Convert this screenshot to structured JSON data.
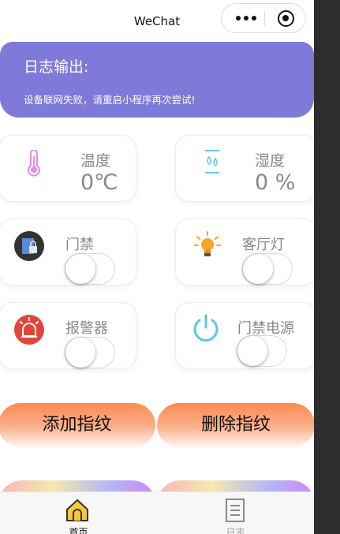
{
  "navbar": {
    "title": "WeChat"
  },
  "log": {
    "title": "日志输出:",
    "message": "设备联网失败，请重启小程序再次尝试!"
  },
  "sensors": {
    "temperature": {
      "label": "温度",
      "value": "0℃",
      "icon": "thermometer-icon",
      "color": "#e28be8"
    },
    "humidity": {
      "label": "湿度",
      "value": "0 %",
      "icon": "humidity-icon",
      "color": "#64d0e0"
    }
  },
  "controls": {
    "door": {
      "label": "门禁",
      "icon": "door-lock-icon",
      "on": false
    },
    "living_room_light": {
      "label": "客厅灯",
      "icon": "light-bulb-icon",
      "on": false
    },
    "alarm": {
      "label": "报警器",
      "icon": "alarm-icon",
      "on": false
    },
    "door_power": {
      "label": "门禁电源",
      "icon": "power-icon",
      "on": false
    }
  },
  "buttons": {
    "add_fingerprint": "添加指纹",
    "delete_fingerprint": "删除指纹"
  },
  "tabbar": {
    "items": [
      {
        "label": "首页",
        "icon": "home-icon",
        "active": true,
        "color": "#111111"
      },
      {
        "label": "日志",
        "icon": "document-icon",
        "active": false,
        "color": "#999999"
      }
    ]
  },
  "colors": {
    "log_bg": "#7f7ad9",
    "button_orange": "#fb8a50",
    "home_icon_fill": "#f5c842"
  }
}
